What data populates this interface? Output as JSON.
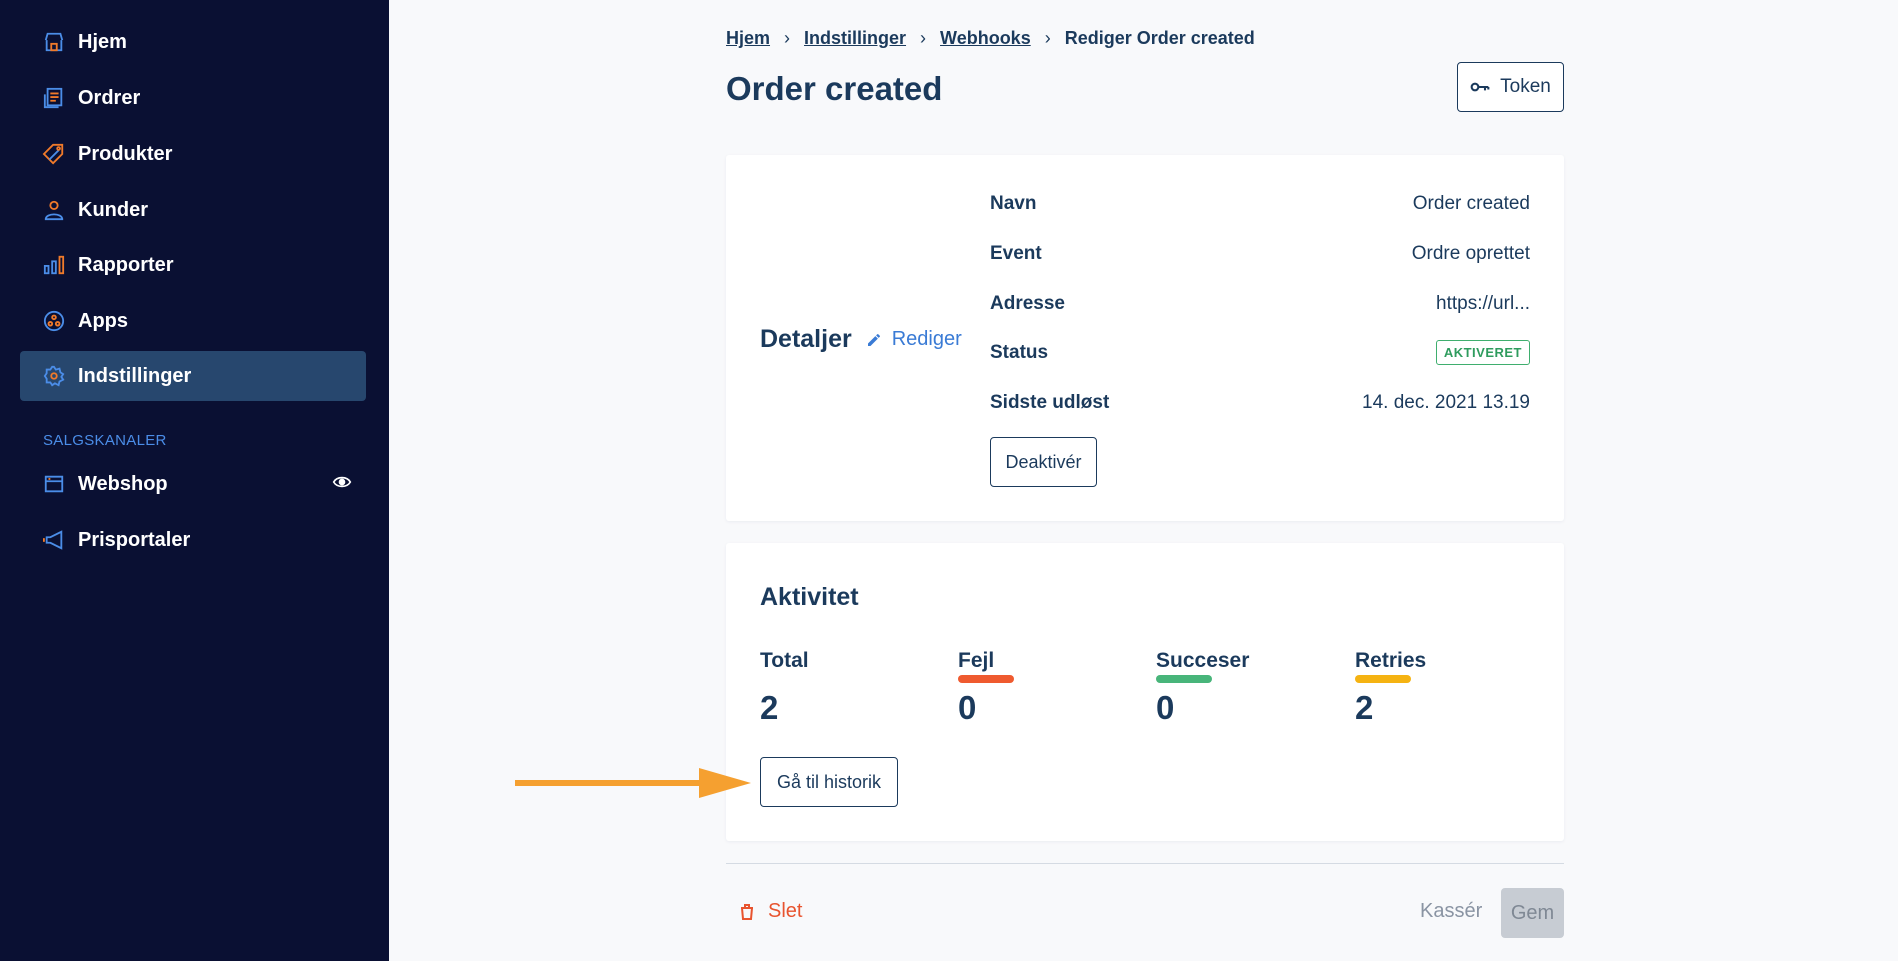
{
  "sidebar": {
    "items": [
      {
        "label": "Hjem",
        "icon": "store-icon"
      },
      {
        "label": "Ordrer",
        "icon": "receipt-icon"
      },
      {
        "label": "Produkter",
        "icon": "tag-icon"
      },
      {
        "label": "Kunder",
        "icon": "person-icon"
      },
      {
        "label": "Rapporter",
        "icon": "bar-chart-icon"
      },
      {
        "label": "Apps",
        "icon": "apps-icon"
      },
      {
        "label": "Indstillinger",
        "icon": "gear-icon",
        "active": true
      }
    ],
    "section_title": "SALGSKANALER",
    "channels": [
      {
        "label": "Webshop",
        "icon": "shop-icon"
      },
      {
        "label": "Prisportaler",
        "icon": "megaphone-icon"
      }
    ]
  },
  "breadcrumb": {
    "items": [
      "Hjem",
      "Indstillinger",
      "Webhooks"
    ],
    "current": "Rediger Order created"
  },
  "page": {
    "title": "Order created",
    "token_label": "Token"
  },
  "details": {
    "title": "Detaljer",
    "edit_label": "Rediger",
    "rows": [
      {
        "key": "Navn",
        "value": "Order created"
      },
      {
        "key": "Event",
        "value": "Ordre oprettet"
      },
      {
        "key": "Adresse",
        "value": "https://url..."
      },
      {
        "key": "Status",
        "value": "AKTIVERET"
      },
      {
        "key": "Sidste udløst",
        "value": "14. dec. 2021 13.19"
      }
    ],
    "deactivate_label": "Deaktivér"
  },
  "activity": {
    "title": "Aktivitet",
    "stats": [
      {
        "label": "Total",
        "value": "2",
        "color": ""
      },
      {
        "label": "Fejl",
        "value": "0",
        "color": "#ef5a2f"
      },
      {
        "label": "Succeser",
        "value": "0",
        "color": "#48b57a"
      },
      {
        "label": "Retries",
        "value": "2",
        "color": "#f5b312"
      }
    ],
    "history_label": "Gå til historik"
  },
  "footer": {
    "delete_label": "Slet",
    "discard_label": "Kassér",
    "save_label": "Gem"
  },
  "colors": {
    "sidebar_bg": "#0a1033",
    "active_bg": "#27476e",
    "icon_orange": "#f07a2a",
    "icon_blue": "#4b8de8",
    "annotation_arrow": "#f5a030"
  }
}
